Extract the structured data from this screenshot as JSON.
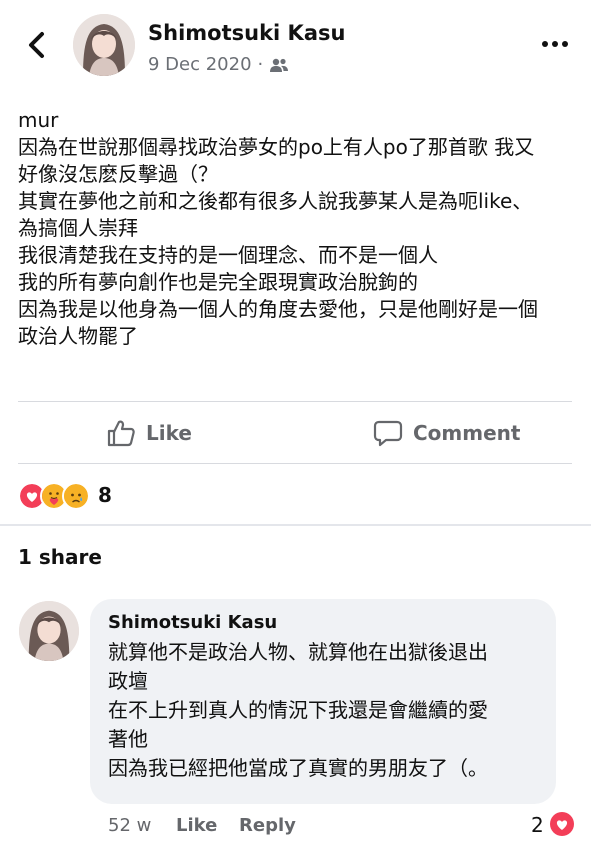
{
  "post": {
    "author": "Shimotsuki Kasu",
    "date": "9 Dec 2020",
    "separator": "·",
    "audience_icon": "friends-icon",
    "lines": [
      "mur",
      "因為在世說那個尋找政治夢女的po上有人po了那首歌 我又",
      "好像沒怎麽反擊過（？",
      "其實在夢他之前和之後都有很多人說我夢某人是為呃like、",
      "為搞個人崇拜",
      "我很清楚我在支持的是一個理念、而不是一個人",
      "我的所有夢向創作也是完全跟現實政治脫鉤的",
      "因為我是以他身為一個人的角度去愛他，只是他剛好是一個",
      "政治人物罷了"
    ]
  },
  "actions": {
    "like_label": "Like",
    "comment_label": "Comment"
  },
  "reactions": {
    "types": [
      "love",
      "care",
      "sad"
    ],
    "colors": {
      "love": "#f33e58",
      "care": "#f7b125",
      "sad": "#f7b125"
    },
    "count": "8"
  },
  "shares": "1 share",
  "comment": {
    "author": "Shimotsuki Kasu",
    "lines": [
      "就算他不是政治人物、就算他在出獄後退出",
      "政壇",
      "在不上升到真人的情況下我還是會繼續的愛",
      "著他",
      "因為我已經把他當成了真實的男朋友了（。"
    ],
    "time": "52 w",
    "like_label": "Like",
    "reply_label": "Reply",
    "reaction_count": "2",
    "reaction_type": "love"
  }
}
